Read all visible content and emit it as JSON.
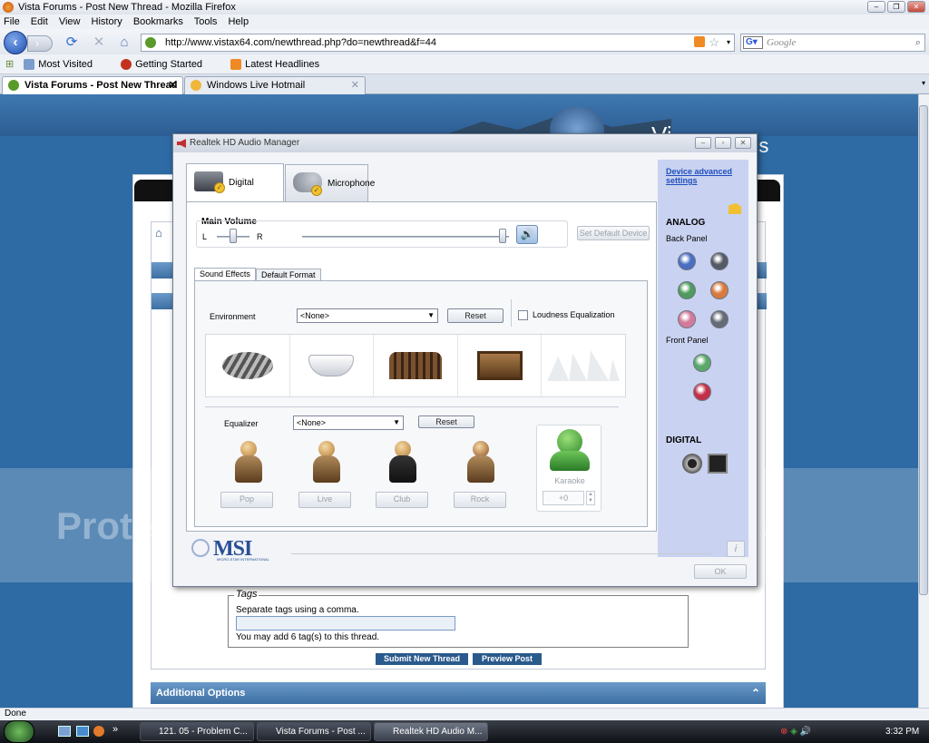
{
  "browser": {
    "title": "Vista Forums - Post New Thread - Mozilla Firefox",
    "menu": [
      "File",
      "Edit",
      "View",
      "History",
      "Bookmarks",
      "Tools",
      "Help"
    ],
    "url": "http://www.vistax64.com/newthread.php?do=newthread&f=44",
    "search_placeholder": "Google",
    "bookmarks": [
      "Most Visited",
      "Getting Started",
      "Latest Headlines"
    ],
    "tabs": [
      {
        "label": "Vista Forums - Post New Thread",
        "active": true
      },
      {
        "label": "Windows Live Hotmail",
        "active": false
      }
    ],
    "status": "Done"
  },
  "page": {
    "site_logo_text": "Vi",
    "site_logo_text_right": "ms",
    "watermark": "Protect more of your memories for less!",
    "tags_legend": "Tags",
    "tags_hint": "Separate tags using a comma.",
    "tags_limit": "You may add 6 tag(s) to this thread.",
    "submit_label": "Submit New Thread",
    "preview_label": "Preview Post",
    "additional_options": "Additional Options"
  },
  "dialog": {
    "title": "Realtek HD Audio Manager",
    "device_tabs": [
      "Digital Output",
      "Microphone"
    ],
    "main_volume_label": "Main Volume",
    "left_label": "L",
    "right_label": "R",
    "set_default_label": "Set Default Device",
    "sub_tabs": [
      "Sound Effects",
      "Default Format"
    ],
    "environment_label": "Environment",
    "environment_value": "<None>",
    "reset_label": "Reset",
    "loudness_label": "Loudness Equalization",
    "equalizer_label": "Equalizer",
    "equalizer_value": "<None>",
    "eq_presets": [
      "Pop",
      "Live",
      "Club",
      "Rock"
    ],
    "karaoke_label": "Karaoke",
    "karaoke_value": "+0",
    "advanced_link": "Device advanced settings",
    "analog_label": "ANALOG",
    "back_panel_label": "Back Panel",
    "front_panel_label": "Front Panel",
    "digital_label": "DIGITAL",
    "ok_label": "OK",
    "brand": "MSI",
    "brand_sub": "MICRO-STAR INTERNATIONAL",
    "jack_colors_back": [
      "#4a6fc2",
      "#555b66",
      "#4f9a5e",
      "#d77a3f",
      "#d27a9a",
      "#656b75"
    ],
    "jack_colors_front": [
      "#5aa86a",
      "#c23048"
    ]
  },
  "taskbar": {
    "items": [
      {
        "label": "121. 05 - Problem C...",
        "active": false
      },
      {
        "label": "Vista Forums - Post ...",
        "active": false
      },
      {
        "label": "Realtek HD Audio M...",
        "active": true
      }
    ],
    "clock": "3:32 PM"
  }
}
